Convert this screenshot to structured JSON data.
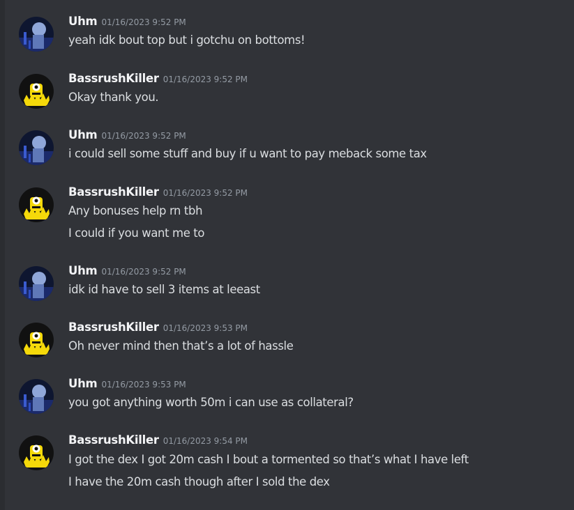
{
  "messages": [
    {
      "user": "Uhm",
      "timestamp": "01/16/2023 9:52 PM",
      "avatar": "uhm-avatar",
      "lines": [
        "yeah idk bout top but i gotchu on bottoms!"
      ]
    },
    {
      "user": "BassrushKiller",
      "timestamp": "01/16/2023 9:52 PM",
      "avatar": "bassrush-avatar",
      "lines": [
        "Okay thank you."
      ]
    },
    {
      "user": "Uhm",
      "timestamp": "01/16/2023 9:52 PM",
      "avatar": "uhm-avatar",
      "lines": [
        "i could sell some stuff and buy if u want to pay meback some tax"
      ]
    },
    {
      "user": "BassrushKiller",
      "timestamp": "01/16/2023 9:52 PM",
      "avatar": "bassrush-avatar",
      "lines": [
        "Any bonuses help rn tbh",
        "I could if you want me to"
      ]
    },
    {
      "user": "Uhm",
      "timestamp": "01/16/2023 9:52 PM",
      "avatar": "uhm-avatar",
      "lines": [
        "idk id have to sell 3 items at leeast"
      ]
    },
    {
      "user": "BassrushKiller",
      "timestamp": "01/16/2023 9:53 PM",
      "avatar": "bassrush-avatar",
      "lines": [
        "Oh never mind then that’s a lot of hassle"
      ]
    },
    {
      "user": "Uhm",
      "timestamp": "01/16/2023 9:53 PM",
      "avatar": "uhm-avatar",
      "lines": [
        "you got anything worth 50m i can use as collateral?"
      ]
    },
    {
      "user": "BassrushKiller",
      "timestamp": "01/16/2023 9:54 PM",
      "avatar": "bassrush-avatar",
      "lines": [
        "I got the dex I got 20m cash I bout a tormented so that’s what I have left",
        "I have the 20m cash though after I sold the dex"
      ]
    }
  ],
  "colors": {
    "background": "#313338",
    "username": "#f2f3f5",
    "timestamp": "#949ba4",
    "text": "#dbdee1"
  }
}
